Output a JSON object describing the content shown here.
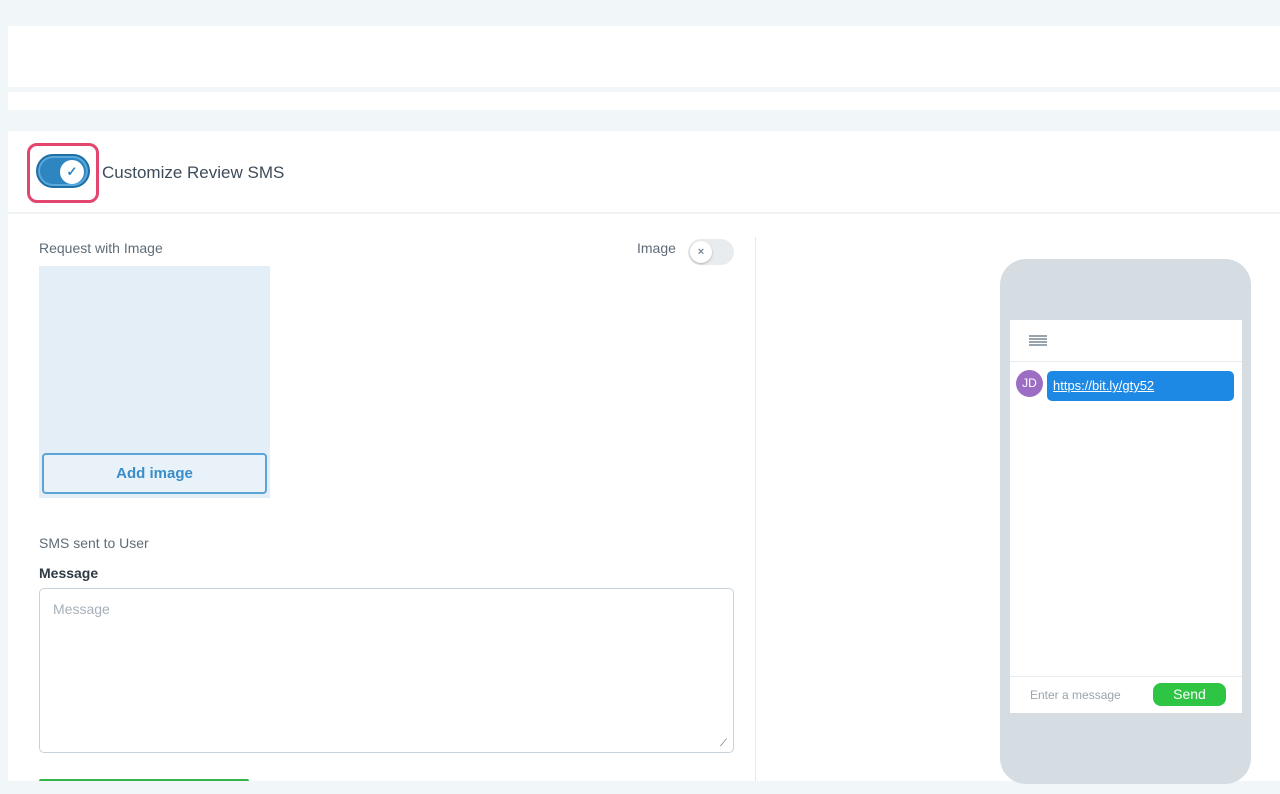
{
  "header": {
    "customize_label": "Customize Review SMS",
    "customize_enabled": true,
    "toggle_on_icon": "check-icon"
  },
  "request": {
    "label": "Request with Image",
    "image_toggle_label": "Image",
    "image_enabled": false,
    "toggle_off_icon": "x-icon",
    "add_image_label": "Add image"
  },
  "sms": {
    "section_label": "SMS sent to User",
    "message_label": "Message",
    "message_placeholder": "Message",
    "message_value": ""
  },
  "preview": {
    "avatar_initials": "JD",
    "link_text": "https://bit.ly/gty52",
    "input_placeholder": "Enter a message",
    "send_label": "Send"
  },
  "colors": {
    "accent": "#2e86c1",
    "highlight": "#e2466f",
    "send_green": "#2ec444",
    "bubble_blue": "#1e88e5",
    "avatar_purple": "#9b6ec4"
  }
}
